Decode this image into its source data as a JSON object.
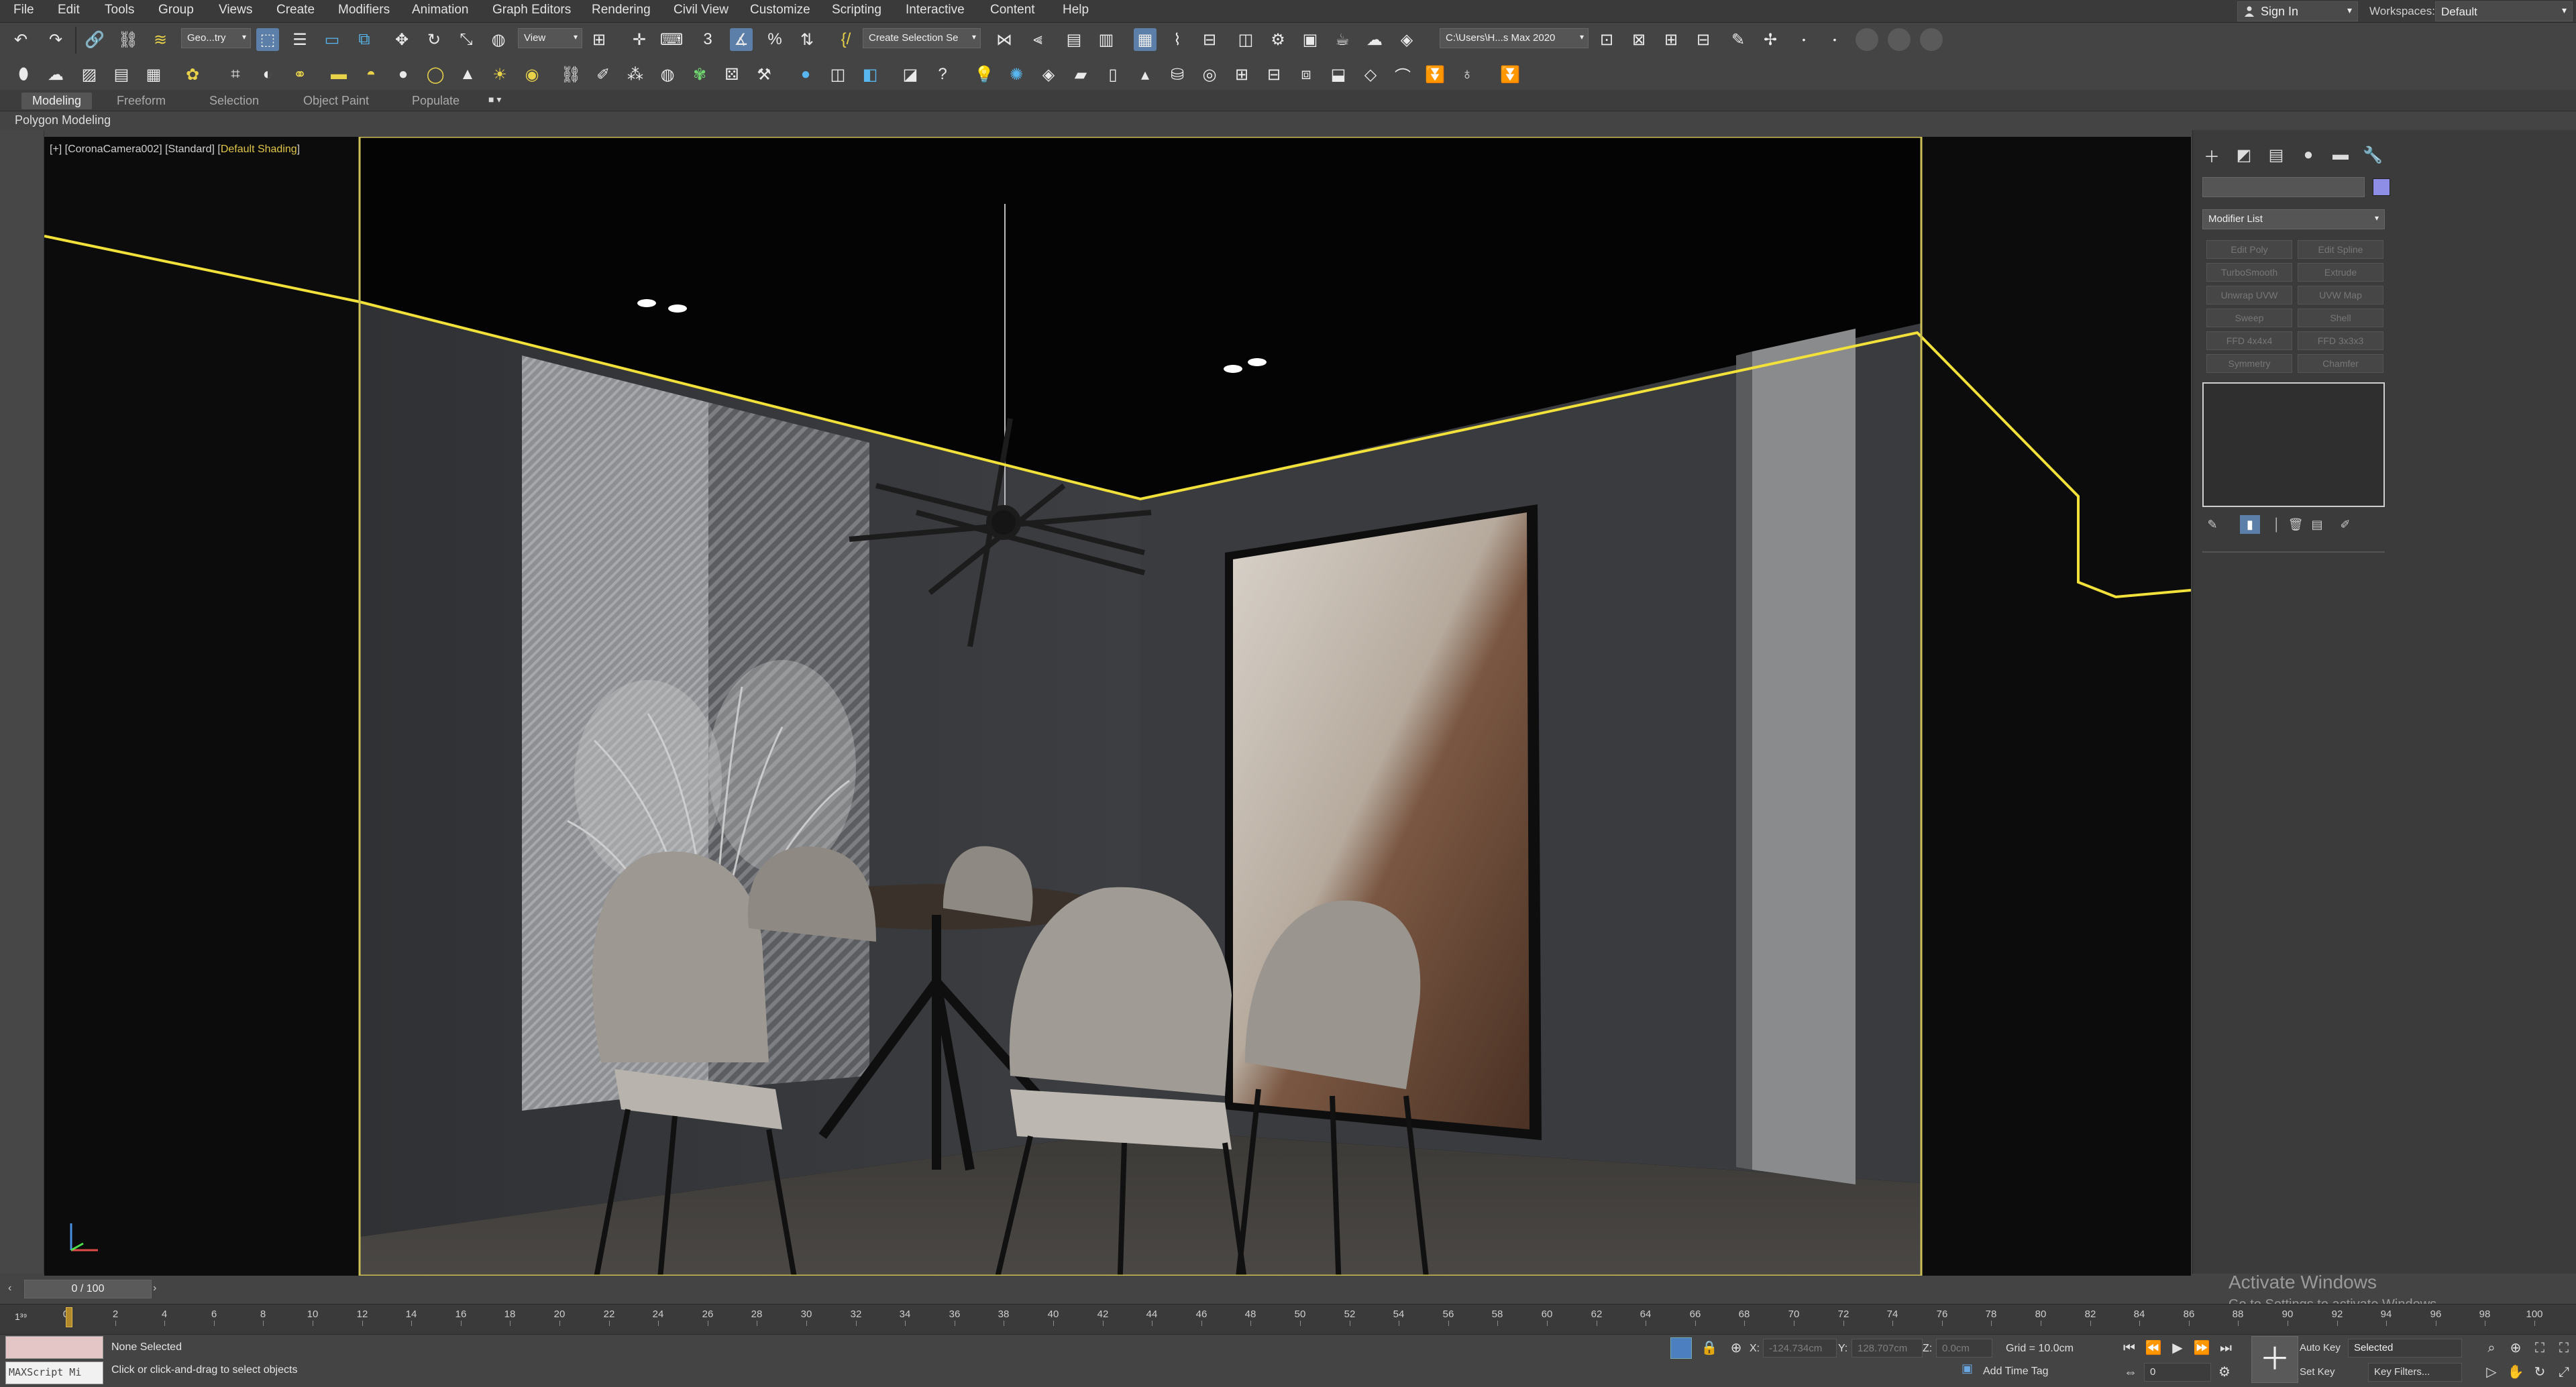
{
  "menu": {
    "items": [
      "File",
      "Edit",
      "Tools",
      "Group",
      "Views",
      "Create",
      "Modifiers",
      "Animation",
      "Graph Editors",
      "Rendering",
      "Civil View",
      "Customize",
      "Scripting",
      "Interactive",
      "Content",
      "Help"
    ]
  },
  "account": {
    "sign_in": "Sign In"
  },
  "workspaces": {
    "label": "Workspaces:",
    "value": "Default"
  },
  "toolbar": {
    "selection_filter": "Geo...try",
    "reference_coord": "View",
    "named_selection": "Create Selection Se",
    "project_path": "C:\\Users\\H...s Max 2020"
  },
  "ribbon": {
    "tabs": [
      "Modeling",
      "Freeform",
      "Selection",
      "Object Paint",
      "Populate"
    ],
    "options": "■ ▾",
    "sub_label": "Polygon Modeling"
  },
  "viewport": {
    "label_prefix": "[+] [CoronaCamera002] [Standard] [",
    "label_shading": "Default Shading",
    "label_suffix": "]"
  },
  "command_panel": {
    "tabs": [
      "create-icon",
      "modify-icon",
      "hierarchy-icon",
      "motion-icon",
      "display-icon",
      "utilities-icon"
    ],
    "modifier_list": "Modifier List",
    "modifier_buttons": [
      "Edit Poly",
      "Edit Spline",
      "TurboSmooth",
      "Extrude",
      "Unwrap UVW",
      "UVW Map",
      "Sweep",
      "Shell",
      "FFD 4x4x4",
      "FFD 3x3x3",
      "Symmetry",
      "Chamfer"
    ],
    "object_color": "#8e8ee6"
  },
  "time_slider": {
    "value": "0 / 100",
    "current_frame": 0,
    "total_frames": 100
  },
  "trackbar": {
    "toggle": "1³⁹",
    "tick_labels": [
      "0",
      "2",
      "4",
      "6",
      "8",
      "10",
      "12",
      "14",
      "16",
      "18",
      "20",
      "22",
      "24",
      "26",
      "28",
      "30",
      "32",
      "34",
      "36",
      "38",
      "40",
      "42",
      "44",
      "46",
      "48",
      "50",
      "52",
      "54",
      "56",
      "58",
      "60",
      "62",
      "64",
      "66",
      "68",
      "70",
      "72",
      "74",
      "76",
      "78",
      "80",
      "82",
      "84",
      "86",
      "88",
      "90",
      "92",
      "94",
      "96",
      "98",
      "100"
    ]
  },
  "watermark": {
    "line1": "Activate Windows",
    "line2": "Go to Settings to activate Windows."
  },
  "status": {
    "maxscript_label": "MAXScript Mi",
    "selection": "None Selected",
    "prompt": "Click or click-and-drag to select objects",
    "x_label": "X:",
    "x_value": "-124.734cm",
    "y_label": "Y:",
    "y_value": "128.707cm",
    "z_label": "Z:",
    "z_value": "0.0cm",
    "grid": "Grid = 10.0cm",
    "add_time_tag": "Add Time Tag",
    "auto_key": "Auto Key",
    "set_key": "Set Key",
    "selected": "Selected",
    "key_filters": "Key Filters...",
    "frame_value": "0"
  }
}
